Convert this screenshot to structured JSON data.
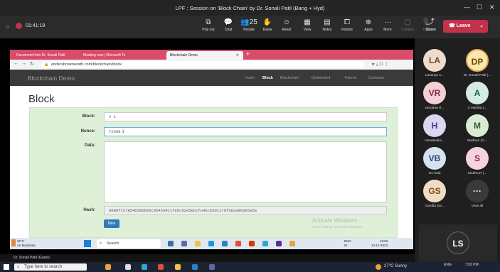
{
  "teams": {
    "meeting_title": "LPF : Session on 'Block Chain' by Dr. Sonali Patil (Bang + Hyd)",
    "timer": "01:41:19",
    "toolbar": [
      {
        "label": "Pop out",
        "icon": "popout-icon"
      },
      {
        "label": "Chat",
        "icon": "chat-icon"
      },
      {
        "label": "People",
        "icon": "people-icon",
        "badge": "25"
      },
      {
        "label": "Raise",
        "icon": "hand-icon"
      },
      {
        "label": "React",
        "icon": "react-icon"
      },
      {
        "label": "View",
        "icon": "view-icon"
      },
      {
        "label": "Notes",
        "icon": "notes-icon"
      },
      {
        "label": "Rooms",
        "icon": "rooms-icon"
      },
      {
        "label": "Apps",
        "icon": "apps-icon"
      },
      {
        "label": "More",
        "icon": "more-icon"
      },
      {
        "label": "Camera",
        "icon": "camera-icon"
      },
      {
        "label": "Mic",
        "icon": "mic-icon"
      },
      {
        "label": "Share",
        "icon": "share-icon"
      }
    ],
    "leave_label": "Leave",
    "presenter_caption": "Dr. Sonali Patil (Guest)",
    "participants": [
      {
        "initials": "LA",
        "name": "Lavanya A...",
        "color": "#f0dccf",
        "text": "#7a4a2a"
      },
      {
        "initials": "DP",
        "name": "Dr. Sonali Patil (...",
        "color": "#fde7b0",
        "text": "#6a4a00"
      },
      {
        "initials": "VR",
        "name": "vandana R...",
        "color": "#f4cfd6",
        "text": "#8a2b40"
      },
      {
        "initials": "A",
        "name": "A.Haritha (...",
        "color": "#d5ece5",
        "text": "#1d5e4c"
      },
      {
        "initials": "H",
        "name": "HimaMalini...",
        "color": "#dcd6f3",
        "text": "#433a86"
      },
      {
        "initials": "M",
        "name": "Madhuri (G...",
        "color": "#d9ecd3",
        "text": "#355e2b"
      },
      {
        "initials": "VB",
        "name": "On hold",
        "color": "#d6e2f0",
        "text": "#2e4b73"
      },
      {
        "initials": "S",
        "name": "Sindhu.R (...",
        "color": "#f6d3dc",
        "text": "#8a2742"
      },
      {
        "initials": "GS",
        "name": "Gandla Sw...",
        "color": "#f3dcc6",
        "text": "#7a4a1a"
      },
      {
        "initials": "···",
        "name": "View all",
        "color": "#3a3a3a",
        "text": "#ffffff"
      }
    ],
    "self_initials": "LS"
  },
  "browser": {
    "tabs": [
      {
        "label": "Document from Dr. Sonali Patil",
        "active": false
      },
      {
        "label": "Meeting now | Microsoft Te",
        "active": false
      },
      {
        "label": "Blockchain Demo",
        "active": true
      }
    ],
    "url": "andersbrownworth.com/blockchain/block"
  },
  "page": {
    "brand": "Blockchain Demo",
    "nav": [
      "Hash",
      "Block",
      "Blockchain",
      "Distributed",
      "Tokens",
      "Coinbase"
    ],
    "active_nav": "Block",
    "heading": "Block",
    "block_label": "Block:",
    "block_value": "# 1",
    "nonce_label": "Nonce:",
    "nonce_value": "72608",
    "data_label": "Data:",
    "data_value": "",
    "hash_label": "Hash:",
    "hash_value": "0000f727854b58bb95c054b39c1fe5c92e5ebcfa4bcb5dc279f56aa96365e5a",
    "mine_label": "Mine",
    "watermark_title": "Activate Windows",
    "watermark_sub": "Go to Settings to activate Windows."
  },
  "remote_taskbar": {
    "weather_temp": "26°C",
    "weather_desc": "Air Moderate",
    "search": "Search",
    "lang": "ENG",
    "region": "IN",
    "time": "19:02",
    "date": "13-12-2023"
  },
  "local_taskbar": {
    "search_placeholder": "Type here to search",
    "weather": "27°C  Sunny",
    "lang": "ENG",
    "time": "7:02 PM"
  }
}
